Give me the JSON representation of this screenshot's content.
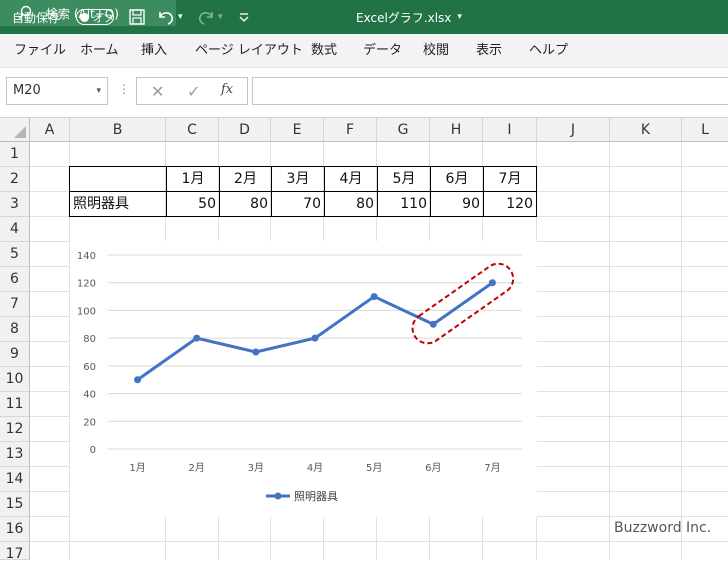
{
  "titlebar": {
    "autosave_label": "自動保存",
    "autosave_state": "オフ",
    "file_name": "Excelグラフ.xlsx",
    "search_placeholder": "検索 (Alt+Q)",
    "accent_color": "#217346"
  },
  "ribbon": {
    "tabs": [
      "ファイル",
      "ホーム",
      "挿入",
      "ページ レイアウト",
      "数式",
      "データ",
      "校閲",
      "表示",
      "ヘルプ"
    ]
  },
  "formula_bar": {
    "name_box": "M20",
    "fx_label": "fx"
  },
  "sheet": {
    "columns": [
      "A",
      "B",
      "C",
      "D",
      "E",
      "F",
      "G",
      "H",
      "I",
      "J",
      "K",
      "L"
    ],
    "rows": [
      "1",
      "2",
      "3",
      "4",
      "5",
      "6",
      "7",
      "8",
      "9",
      "10",
      "11",
      "12",
      "13",
      "14",
      "15",
      "16",
      "17"
    ],
    "table": {
      "headers": [
        "1月",
        "2月",
        "3月",
        "4月",
        "5月",
        "6月",
        "7月"
      ],
      "row_label": "照明器具",
      "values": [
        "50",
        "80",
        "70",
        "80",
        "110",
        "90",
        "120"
      ]
    }
  },
  "chart_data": {
    "type": "line",
    "categories": [
      "1月",
      "2月",
      "3月",
      "4月",
      "5月",
      "6月",
      "7月"
    ],
    "series": [
      {
        "name": "照明器具",
        "values": [
          50,
          80,
          70,
          80,
          110,
          90,
          120
        ],
        "color": "#4472c4"
      }
    ],
    "title": "",
    "xlabel": "",
    "ylabel": "",
    "ylim": [
      0,
      140
    ],
    "yticks": [
      "0",
      "20",
      "40",
      "60",
      "80",
      "100",
      "120",
      "140"
    ],
    "grid": true,
    "legend": "bottom",
    "annotation": {
      "type": "dashed-ellipse",
      "color": "#c00000",
      "highlights": [
        "6月",
        "7月"
      ]
    }
  },
  "watermark": "Buzzword Inc."
}
